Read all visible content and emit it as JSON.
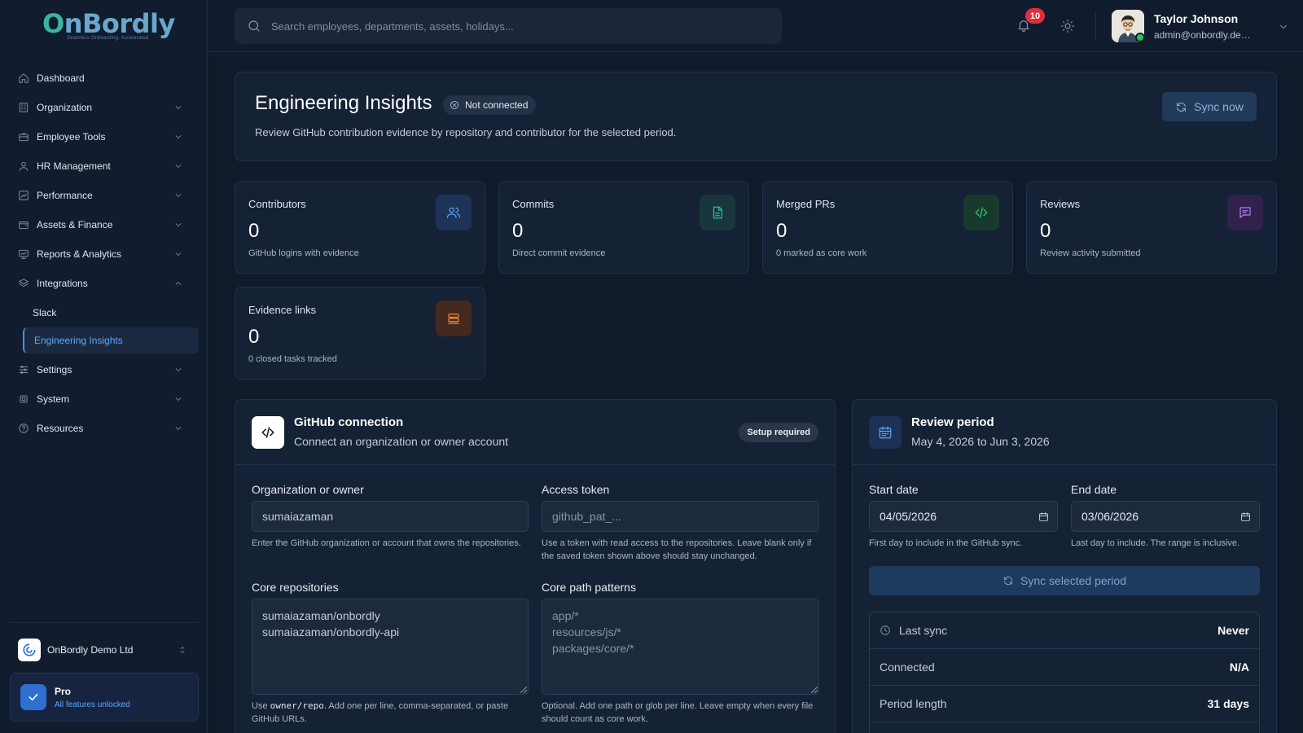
{
  "brand": {
    "name": "OnBordly",
    "tagline": "Seamless Onboarding, Accelerated"
  },
  "sidebar": {
    "items": [
      {
        "label": "Dashboard"
      },
      {
        "label": "Organization"
      },
      {
        "label": "Employee Tools"
      },
      {
        "label": "HR Management"
      },
      {
        "label": "Performance"
      },
      {
        "label": "Assets & Finance"
      },
      {
        "label": "Reports & Analytics"
      },
      {
        "label": "Integrations"
      },
      {
        "label": "Settings"
      },
      {
        "label": "System"
      },
      {
        "label": "Resources"
      }
    ],
    "integrations_sub": [
      {
        "label": "Slack"
      },
      {
        "label": "Engineering Insights"
      }
    ],
    "company": "OnBordly Demo Ltd",
    "plan": {
      "title": "Pro",
      "subtitle": "All features unlocked"
    }
  },
  "topbar": {
    "search_placeholder": "Search employees, departments, assets, holidays...",
    "notification_count": "10",
    "user": {
      "name": "Taylor Johnson",
      "email": "admin@onbordly.demo"
    }
  },
  "header": {
    "title": "Engineering Insights",
    "status": "Not connected",
    "description": "Review GitHub contribution evidence by repository and contributor for the selected period.",
    "sync_label": "Sync now"
  },
  "stats": [
    {
      "label": "Contributors",
      "value": "0",
      "sub": "GitHub logins with evidence"
    },
    {
      "label": "Commits",
      "value": "0",
      "sub": "Direct commit evidence"
    },
    {
      "label": "Merged PRs",
      "value": "0",
      "sub": "0 marked as core work"
    },
    {
      "label": "Reviews",
      "value": "0",
      "sub": "Review activity submitted"
    },
    {
      "label": "Evidence links",
      "value": "0",
      "sub": "0 closed tasks tracked"
    }
  ],
  "colors": {
    "contributors": "#5aa9ff",
    "commits": "#2ec4a0",
    "merged_prs": "#3ccf6e",
    "reviews": "#b57cf5",
    "evidence": "#f08a3c"
  },
  "github": {
    "title": "GitHub connection",
    "subtitle": "Connect an organization or owner account",
    "badge": "Setup required",
    "org_label": "Organization or owner",
    "org_value": "sumaiazaman",
    "org_help": "Enter the GitHub organization or account that owns the repositories.",
    "token_label": "Access token",
    "token_placeholder": "github_pat_...",
    "token_help": "Use a token with read access to the repositories. Leave blank only if the saved token shown above should stay unchanged.",
    "repos_label": "Core repositories",
    "repos_value": "sumaiazaman/onbordly\nsumaiazaman/onbordly-api",
    "repos_help_pre": "Use ",
    "repos_help_code": "owner/repo",
    "repos_help_post": ". Add one per line, comma-separated, or paste GitHub URLs.",
    "paths_label": "Core path patterns",
    "paths_placeholder": "app/*\nresources/js/*\npackages/core/*",
    "paths_help": "Optional. Add one path or glob per line. Leave empty when every file should count as core work."
  },
  "review": {
    "title": "Review period",
    "range": "May 4, 2026 to Jun 3, 2026",
    "start_label": "Start date",
    "start_value": "04/05/2026",
    "start_help": "First day to include in the GitHub sync.",
    "end_label": "End date",
    "end_value": "03/06/2026",
    "end_help": "Last day to include. The range is inclusive.",
    "sync_label": "Sync selected period",
    "rows": [
      {
        "k": "Last sync",
        "v": "Never"
      },
      {
        "k": "Connected",
        "v": "N/A"
      },
      {
        "k": "Period length",
        "v": "31 days"
      }
    ]
  }
}
